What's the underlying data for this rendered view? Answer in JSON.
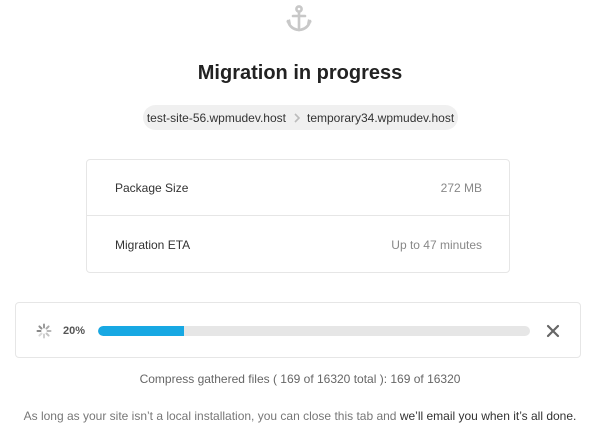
{
  "header": {
    "icon": "anchor-icon",
    "title": "Migration in progress"
  },
  "route": {
    "source": "test-site-56.wpmudev.host",
    "separator_icon": "chevron-right-icon",
    "destination": "temporary34.wpmudev.host"
  },
  "details": [
    {
      "label": "Package Size",
      "value": "272 MB"
    },
    {
      "label": "Migration ETA",
      "value": "Up to 47 minutes"
    }
  ],
  "progress": {
    "spinner_icon": "spinner-icon",
    "percent_label": "20%",
    "fraction": 0.2,
    "bar_color": "#17a8e3",
    "cancel_icon": "close-icon"
  },
  "status": "Compress gathered files ( 169 of 16320 total ): 169 of 16320",
  "footer": {
    "prefix": "As long as your site isn’t a local installation, you can close this tab and ",
    "emphasis": "we’ll email you when it’s all done."
  }
}
